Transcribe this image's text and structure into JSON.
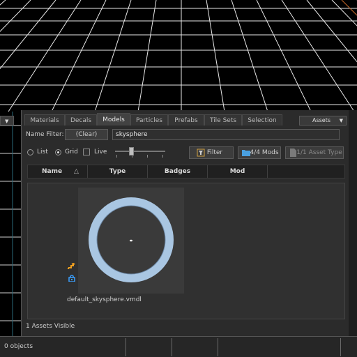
{
  "tabs": [
    "Materials",
    "Decals",
    "Models",
    "Particles",
    "Prefabs",
    "Tile Sets",
    "Selection"
  ],
  "active_tab": "Models",
  "assets_dropdown": "Assets",
  "name_filter": {
    "label": "Name Filter:",
    "clear_button": "(Clear)",
    "value": "skysphere"
  },
  "view_options": {
    "list_label": "List",
    "grid_label": "Grid",
    "live_label": "Live",
    "selected": "Grid"
  },
  "toolbar": {
    "filter_button": "Filter",
    "mods_button": "4/4 Mods",
    "asset_type_button": "1/1 Asset Type"
  },
  "columns": [
    "Name",
    "Type",
    "Badges",
    "Mod"
  ],
  "asset": {
    "filename": "default_skysphere.vmdl"
  },
  "assets_visible": "1 Assets Visible",
  "status": {
    "objects": "0 objects"
  },
  "colors": {
    "ring": "#a9c6e2",
    "grid_line": "#ffffff",
    "lock_icon": "#3aa0ff",
    "link_icon": "#f0a020"
  }
}
